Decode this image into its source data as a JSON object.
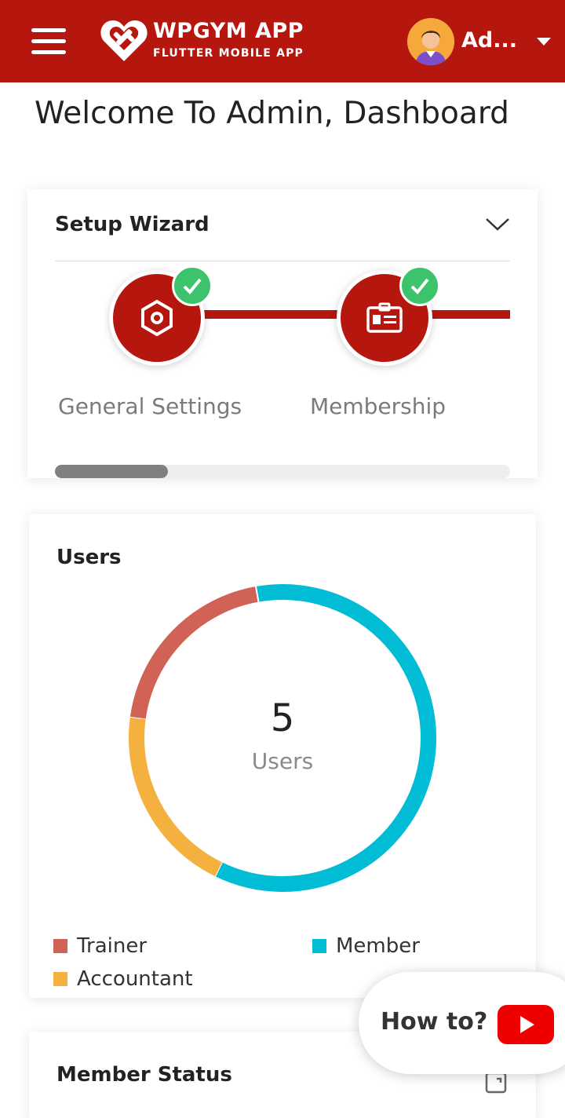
{
  "header": {
    "brand_title": "WPGYM APP",
    "brand_subtitle": "FLUTTER MOBILE APP",
    "user_name": "Ad...",
    "accent_color": "#b5170e"
  },
  "welcome_text": "Welcome To Admin, Dashboard",
  "setup_wizard": {
    "title": "Setup Wizard",
    "steps": [
      {
        "label": "General Settings",
        "icon": "settings-hexagon-icon",
        "completed": true
      },
      {
        "label": "Membership",
        "icon": "id-card-icon",
        "completed": true
      }
    ],
    "scroll_fraction": 0.25
  },
  "users_card": {
    "title": "Users",
    "total": "5",
    "total_label": "Users",
    "chart_data": {
      "type": "pie",
      "categories": [
        "Member",
        "Accountant",
        "Trainer"
      ],
      "values": [
        3,
        1,
        1
      ],
      "colors": [
        "#00bcd4",
        "#f4b13f",
        "#d06355"
      ]
    },
    "legend": [
      {
        "label": "Trainer",
        "color": "#d06355"
      },
      {
        "label": "Member",
        "color": "#00bcd4"
      },
      {
        "label": "Accountant",
        "color": "#f4b13f"
      }
    ]
  },
  "member_status": {
    "title": "Member Status"
  },
  "how_to": {
    "label": "How to?"
  }
}
